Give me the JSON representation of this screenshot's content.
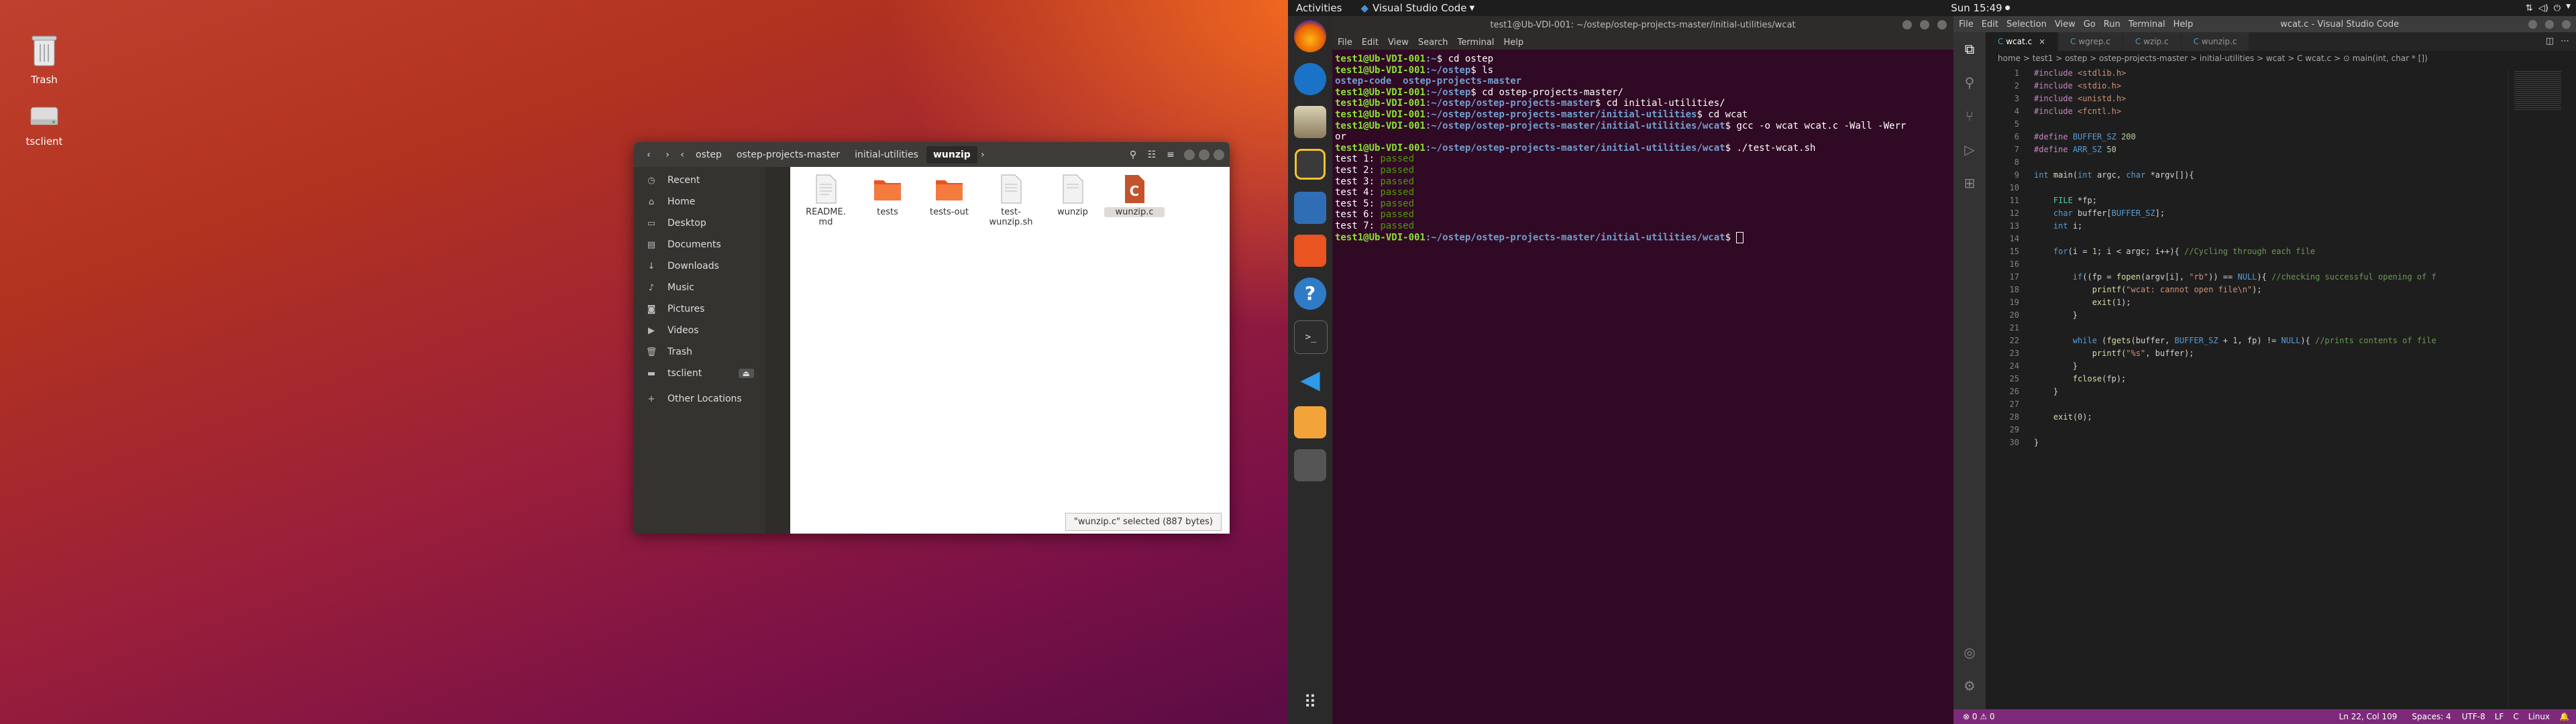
{
  "desktop": {
    "icons": [
      {
        "label": "Trash",
        "icon": "trash-icon"
      },
      {
        "label": "tsclient",
        "icon": "drive-icon"
      }
    ]
  },
  "files": {
    "path": [
      "ostep",
      "ostep-projects-master",
      "initial-utilities",
      "wunzip"
    ],
    "sidebar": [
      {
        "label": "Recent",
        "icon": "clock-icon"
      },
      {
        "label": "Home",
        "icon": "home-icon"
      },
      {
        "label": "Desktop",
        "icon": "desktop-icon"
      },
      {
        "label": "Documents",
        "icon": "documents-icon"
      },
      {
        "label": "Downloads",
        "icon": "download-icon"
      },
      {
        "label": "Music",
        "icon": "music-icon"
      },
      {
        "label": "Pictures",
        "icon": "pictures-icon"
      },
      {
        "label": "Videos",
        "icon": "videos-icon"
      },
      {
        "label": "Trash",
        "icon": "trash-icon"
      },
      {
        "label": "tsclient",
        "icon": "drive-icon"
      },
      {
        "label": "Other Locations",
        "icon": "plus-icon"
      }
    ],
    "items": [
      {
        "name": "README.\nmd",
        "kind": "text"
      },
      {
        "name": "tests",
        "kind": "folder"
      },
      {
        "name": "tests-out",
        "kind": "folder"
      },
      {
        "name": "test-\nwunzip.sh",
        "kind": "text"
      },
      {
        "name": "wunzip",
        "kind": "text"
      },
      {
        "name": "wunzip.c",
        "kind": "c-source"
      }
    ],
    "status": "\"wunzip.c\" selected (887 bytes)"
  },
  "topbar": {
    "activities": "Activities",
    "app": "Visual Studio Code",
    "clock": "Sun 15:49"
  },
  "terminal": {
    "title": "test1@Ub-VDI-001: ~/ostep/ostep-projects-master/initial-utilities/wcat",
    "menu": [
      "File",
      "Edit",
      "View",
      "Search",
      "Terminal",
      "Help"
    ],
    "lines": [
      {
        "user": "test1@Ub-VDI-001",
        "path": ":~",
        "cmd": "$ cd ostep"
      },
      {
        "user": "test1@Ub-VDI-001",
        "path": ":~/ostep",
        "cmd": "$ ls"
      },
      {
        "listing": [
          "ostep-code",
          "ostep-projects-master"
        ]
      },
      {
        "user": "test1@Ub-VDI-001",
        "path": ":~/ostep",
        "cmd": "$ cd ostep-projects-master/"
      },
      {
        "user": "test1@Ub-VDI-001",
        "path": ":~/ostep/ostep-projects-master",
        "cmd": "$ cd initial-utilities/"
      },
      {
        "user": "test1@Ub-VDI-001",
        "path": ":~/ostep/ostep-projects-master/initial-utilities",
        "cmd": "$ cd wcat"
      },
      {
        "user": "test1@Ub-VDI-001",
        "path": ":~/ostep/ostep-projects-master/initial-utilities/wcat",
        "cmd": "$ gcc -o wcat wcat.c -Wall -Werr"
      },
      {
        "text": "or"
      },
      {
        "user": "test1@Ub-VDI-001",
        "path": ":~/ostep/ostep-projects-master/initial-utilities/wcat",
        "cmd": "$ ./test-wcat.sh"
      },
      {
        "test": "test 1: ",
        "result": "passed"
      },
      {
        "test": "test 2: ",
        "result": "passed"
      },
      {
        "test": "test 3: ",
        "result": "passed"
      },
      {
        "test": "test 4: ",
        "result": "passed"
      },
      {
        "test": "test 5: ",
        "result": "passed"
      },
      {
        "test": "test 6: ",
        "result": "passed"
      },
      {
        "test": "test 7: ",
        "result": "passed"
      },
      {
        "user": "test1@Ub-VDI-001",
        "path": ":~/ostep/ostep-projects-master/initial-utilities/wcat",
        "cmd": "$ "
      }
    ]
  },
  "vscode": {
    "title": "wcat.c - Visual Studio Code",
    "menu": [
      "File",
      "Edit",
      "Selection",
      "View",
      "Go",
      "Run",
      "Terminal",
      "Help"
    ],
    "tabs": [
      "wcat.c",
      "wgrep.c",
      "wzip.c",
      "wunzip.c"
    ],
    "breadcrumb": "home > test1 > ostep > ostep-projects-master > initial-utilities > wcat > C wcat.c > ⊙ main(int, char * [])",
    "code": [
      "#include <stdlib.h>",
      "#include <stdio.h>",
      "#include <unistd.h>",
      "#include <fcntl.h>",
      "",
      "#define BUFFER_SZ 200",
      "#define ARR_SZ 50",
      "",
      "int main(int argc, char *argv[]){",
      "",
      "    FILE *fp;",
      "    char buffer[BUFFER_SZ];",
      "    int i;",
      "",
      "    for(i = 1; i < argc; i++){ //Cycling through each file",
      "",
      "        if((fp = fopen(argv[i], \"rb\")) == NULL){ //checking successful opening of f",
      "            printf(\"wcat: cannot open file\\n\");",
      "            exit(1);",
      "        }",
      "",
      "        while (fgets(buffer, BUFFER_SZ + 1, fp) != NULL){ //prints contents of file",
      "            printf(\"%s\", buffer);",
      "        }",
      "        fclose(fp);",
      "    }",
      "",
      "    exit(0);",
      "",
      "}"
    ],
    "status": {
      "errors": "⊗ 0 ⚠ 0",
      "position": "Ln 22, Col 109",
      "spaces": "Spaces: 4",
      "encoding": "UTF-8",
      "eol": "LF",
      "lang": "C",
      "os": "Linux"
    }
  }
}
